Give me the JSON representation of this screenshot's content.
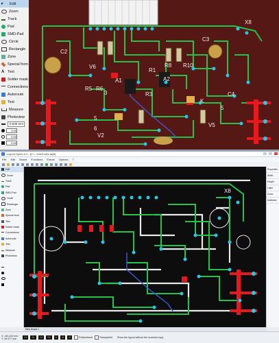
{
  "top_toolbar": {
    "items": [
      {
        "label": "Edit",
        "icon": "arrow-cursor-icon",
        "selected": true
      },
      {
        "label": "Zoom",
        "icon": "magnifier-icon"
      },
      {
        "label": "Track",
        "icon": "track-icon"
      },
      {
        "label": "Pad",
        "icon": "pad-icon"
      },
      {
        "label": "SMD-Pad",
        "icon": "smd-pad-icon"
      },
      {
        "label": "Circle",
        "icon": "circle-icon"
      },
      {
        "label": "Rectangle",
        "icon": "rectangle-icon"
      },
      {
        "label": "Zone",
        "icon": "zone-icon"
      },
      {
        "label": "Special form",
        "icon": "special-form-icon"
      },
      {
        "label": "Text",
        "icon": "text-icon"
      },
      {
        "label": "Solder mask",
        "icon": "solder-mask-icon"
      },
      {
        "label": "Connections",
        "icon": "connections-icon"
      },
      {
        "label": "Autoroute",
        "icon": "autoroute-icon"
      },
      {
        "label": "Test",
        "icon": "test-icon"
      },
      {
        "label": "Measure",
        "icon": "measure-icon"
      },
      {
        "label": "Photoview",
        "icon": "photoview-icon"
      }
    ],
    "width_value": "0.635 mm",
    "rows": [
      "0.00",
      "0.00",
      "0.00"
    ]
  },
  "top_pcb": {
    "labels": [
      "C2",
      "C3",
      "C4",
      "X8",
      "R5",
      "R6",
      "R8",
      "R10",
      "V6",
      "V5",
      "V2",
      "A1",
      "A2",
      "R1",
      "R3",
      "K",
      "5",
      "6",
      "3",
      "5"
    ]
  },
  "bottom_window": {
    "title": "Layout Sprint 6.0 - [C:\\...\\mm3-slim.lay6]",
    "menu": [
      "File",
      "Edit",
      "Board",
      "Functions",
      "Extras",
      "Options",
      "?"
    ],
    "tools": [
      "Edit",
      "Zoom",
      "Track",
      "Pad",
      "SMD-Pad",
      "Circle",
      "Rectangle",
      "Zone",
      "Special form",
      "Text",
      "Solder mask",
      "Connections",
      "Autoroute",
      "Test",
      "Measure",
      "Photoview"
    ],
    "right_panel": [
      "Properties",
      "Width",
      "Height",
      "Layer",
      "Zoom",
      "Multiview"
    ],
    "board_tab": "New board 1",
    "status": {
      "x": "X: 140.423 mm",
      "y": "Y: 39.577 mm",
      "layers": [
        "C1",
        "S1",
        "C2",
        "S2",
        "I1",
        "I2",
        "O"
      ],
      "options": [
        "Rubberband",
        "Transparent"
      ],
      "hint": "Show the layout without the scanned copy"
    }
  },
  "colors": {
    "pcb_top": "#4a1512",
    "pcb_bottom": "#0d0d0d",
    "trace": "#27c24c",
    "pad": "#28c9e6",
    "copper_red": "#e6191e"
  }
}
